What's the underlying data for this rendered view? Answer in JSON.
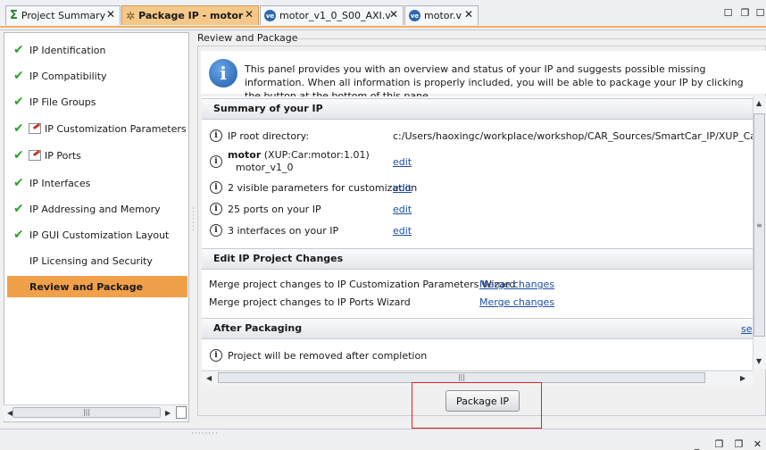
{
  "tabs": [
    {
      "label": "Project Summary",
      "icon": "sigma-icon"
    },
    {
      "label": "Package IP - motor",
      "icon": "package-ip-icon",
      "active": true
    },
    {
      "label": "motor_v1_0_S00_AXI.v",
      "icon": "verilog-file-icon"
    },
    {
      "label": "motor.v",
      "icon": "verilog-file-icon"
    }
  ],
  "ve_badge": "ve",
  "steps": [
    {
      "label": "IP Identification",
      "status": "done"
    },
    {
      "label": "IP Compatibility",
      "status": "done"
    },
    {
      "label": "IP File Groups",
      "status": "done"
    },
    {
      "label": "IP Customization Parameters",
      "status": "done-edited"
    },
    {
      "label": "IP Ports",
      "status": "done-edited"
    },
    {
      "label": "IP Interfaces",
      "status": "done"
    },
    {
      "label": "IP Addressing and Memory",
      "status": "done"
    },
    {
      "label": "IP GUI Customization Layout",
      "status": "done"
    },
    {
      "label": "IP Licensing and Security",
      "status": "none"
    },
    {
      "label": "Review and Package",
      "status": "active"
    }
  ],
  "section_title": "Review and Package",
  "info_text": "This panel provides you with an overview and status of your IP and suggests possible missing information. When all information is properly included, you will be able to package your IP by clicking the button at the bottom of this pane.",
  "summary": {
    "header": "Summary of your IP",
    "root_label": "IP root directory:",
    "root_value": "c:/Users/haoxingc/workplace/workshop/CAR_Sources/SmartCar_IP/XUP_Car_motor",
    "ip_name": "motor",
    "ip_vlnv": " (XUP:Car:motor:1.01)",
    "ip_display": "motor_v1_0",
    "params_text": "2 visible parameters for customization",
    "ports_text": "25 ports on your IP",
    "interfaces_text": "3 interfaces on your IP",
    "edit_label": "edit"
  },
  "project_changes": {
    "header": "Edit IP Project Changes",
    "rows": [
      {
        "text": "Merge project changes to IP Customization Parameters Wizard",
        "link": "Merge changes"
      },
      {
        "text": "Merge project changes to IP Ports Wizard",
        "link": "Merge changes"
      }
    ]
  },
  "after_packaging": {
    "header": "After Packaging",
    "link": "se",
    "row": "Project will be removed after completion"
  },
  "package_button": "Package IP",
  "colors": {
    "accent": "#f1a04a",
    "link": "#1f4fa3",
    "highlight": "#e02020"
  }
}
